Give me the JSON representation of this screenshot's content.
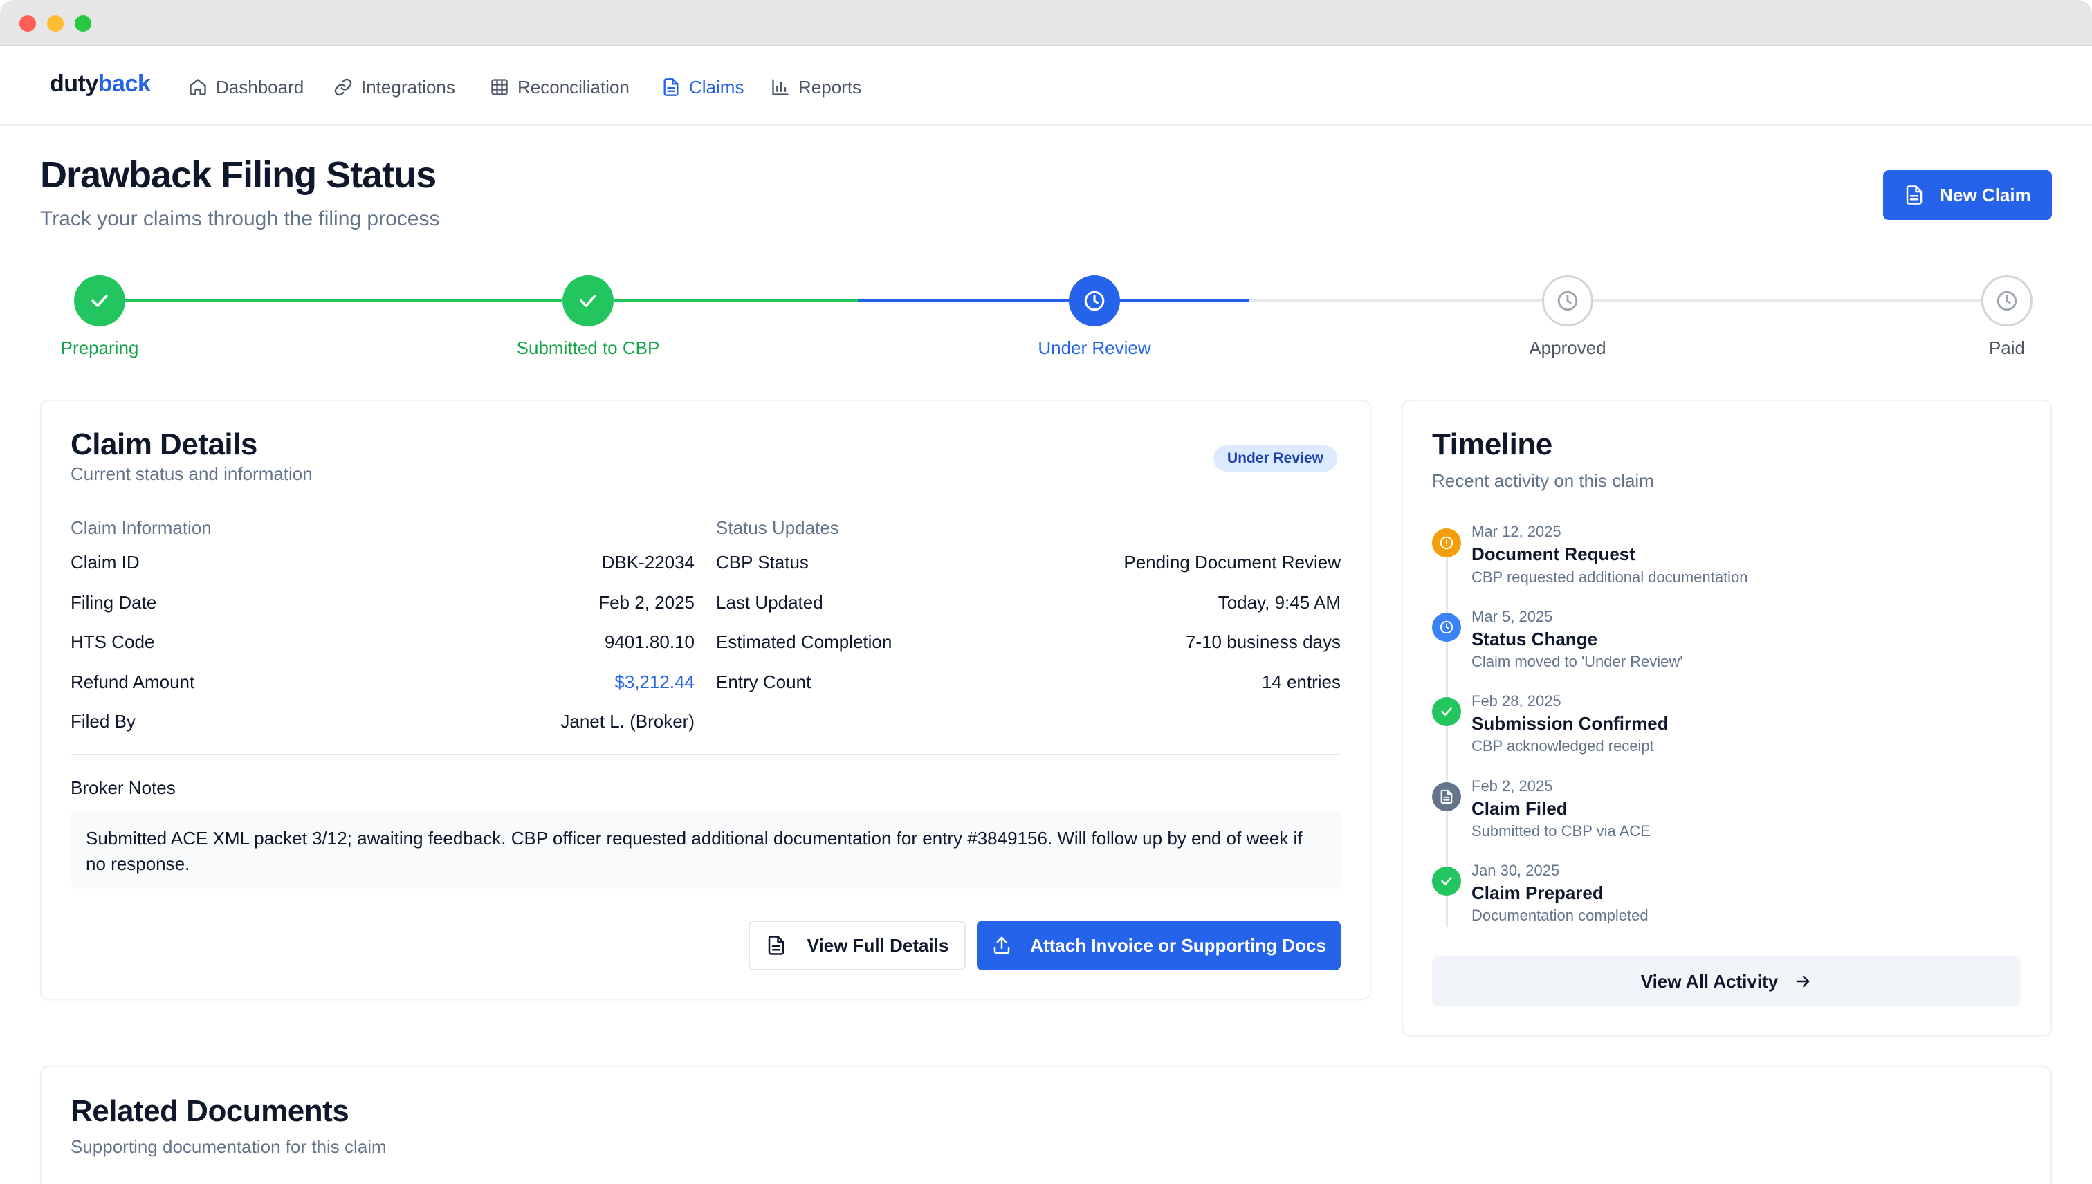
{
  "nav": {
    "logo_part1": "duty",
    "logo_part2": "back",
    "items": [
      {
        "label": "Dashboard",
        "icon": "home-icon"
      },
      {
        "label": "Integrations",
        "icon": "link-icon"
      },
      {
        "label": "Reconciliation",
        "icon": "grid-icon"
      },
      {
        "label": "Claims",
        "icon": "document-icon",
        "active": true
      },
      {
        "label": "Reports",
        "icon": "bar-chart-icon"
      }
    ]
  },
  "header": {
    "title": "Drawback Filing Status",
    "subtitle": "Track your claims through the filing process",
    "new_claim_label": "New Claim"
  },
  "progress": {
    "steps": [
      {
        "label": "Preparing",
        "state": "done"
      },
      {
        "label": "Submitted to CBP",
        "state": "done"
      },
      {
        "label": "Under Review",
        "state": "current"
      },
      {
        "label": "Approved",
        "state": "pending"
      },
      {
        "label": "Paid",
        "state": "pending"
      }
    ]
  },
  "claim_details": {
    "title": "Claim Details",
    "subtitle": "Current status and information",
    "badge": "Under Review",
    "info_heading": "Claim Information",
    "info": [
      {
        "key": "Claim ID",
        "value": "DBK-22034"
      },
      {
        "key": "Filing Date",
        "value": "Feb 2, 2025"
      },
      {
        "key": "HTS Code",
        "value": "9401.80.10"
      },
      {
        "key": "Refund Amount",
        "value": "$3,212.44"
      },
      {
        "key": "Filed By",
        "value": "Janet L. (Broker)"
      }
    ],
    "status_heading": "Status Updates",
    "status": [
      {
        "key": "CBP Status",
        "value": "Pending Document Review"
      },
      {
        "key": "Last Updated",
        "value": "Today, 9:45 AM"
      },
      {
        "key": "Estimated Completion",
        "value": "7-10 business days"
      },
      {
        "key": "Entry Count",
        "value": "14 entries"
      }
    ],
    "notes_label": "Broker Notes",
    "notes": "Submitted ACE XML packet 3/12; awaiting feedback. CBP officer requested additional documentation for entry #3849156. Will follow up by end of week if no response.",
    "view_full_label": "View Full Details",
    "attach_label": "Attach Invoice or Supporting Docs"
  },
  "timeline": {
    "title": "Timeline",
    "subtitle": "Recent activity on this claim",
    "events": [
      {
        "date": "Mar 12, 2025",
        "title": "Document Request",
        "desc": "CBP requested additional documentation",
        "icon": "alert-icon",
        "color": "#f59e0b"
      },
      {
        "date": "Mar 5, 2025",
        "title": "Status Change",
        "desc": "Claim moved to 'Under Review'",
        "icon": "clock-icon",
        "color": "#3b82f6"
      },
      {
        "date": "Feb 28, 2025",
        "title": "Submission Confirmed",
        "desc": "CBP acknowledged receipt",
        "icon": "check-icon",
        "color": "#22c55e"
      },
      {
        "date": "Feb 2, 2025",
        "title": "Claim Filed",
        "desc": "Submitted to CBP via ACE",
        "icon": "document-icon",
        "color": "#64748b"
      },
      {
        "date": "Jan 30, 2025",
        "title": "Claim Prepared",
        "desc": "Documentation completed",
        "icon": "check-icon",
        "color": "#22c55e"
      }
    ],
    "view_all_label": "View All Activity"
  },
  "related_documents": {
    "title": "Related Documents",
    "subtitle": "Supporting documentation for this claim"
  },
  "colors": {
    "accent": "#2563eb",
    "success": "#22c55e",
    "warning": "#f59e0b",
    "muted": "#64748b"
  }
}
